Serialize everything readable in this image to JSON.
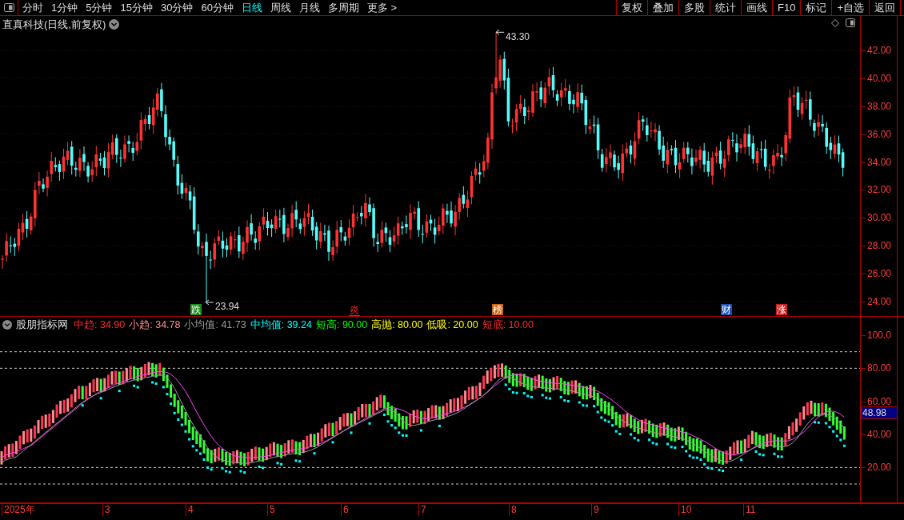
{
  "toolbar": {
    "periods": [
      {
        "label": "分时",
        "selected": false
      },
      {
        "label": "1分钟",
        "selected": false
      },
      {
        "label": "5分钟",
        "selected": false
      },
      {
        "label": "15分钟",
        "selected": false
      },
      {
        "label": "30分钟",
        "selected": false
      },
      {
        "label": "60分钟",
        "selected": false
      },
      {
        "label": "日线",
        "selected": true
      },
      {
        "label": "周线",
        "selected": false
      },
      {
        "label": "月线",
        "selected": false
      },
      {
        "label": "多周期",
        "selected": false
      },
      {
        "label": "更多 >",
        "selected": false
      }
    ],
    "buttons": [
      "复权",
      "叠加",
      "多股",
      "统计",
      "画线",
      "F10",
      "标记",
      "+自选",
      "返回"
    ]
  },
  "chart": {
    "title": "直真科技(日线,前复权)",
    "y_axis": [
      "42.00",
      "40.00",
      "38.00",
      "36.00",
      "34.00",
      "32.00",
      "30.00",
      "28.00",
      "26.00",
      "24.00"
    ],
    "high_label": "43.30",
    "low_label": "23.94",
    "events": [
      {
        "text": "跌",
        "kind": "tag",
        "color": "#1e8c1e"
      },
      {
        "text": "炎",
        "kind": "text",
        "color": "#ff2020"
      },
      {
        "text": "榜",
        "kind": "tag",
        "color": "#c86414"
      },
      {
        "text": "财",
        "kind": "tag",
        "color": "#1e50b4"
      },
      {
        "text": "涨",
        "kind": "tag",
        "color": "#c81e1e"
      }
    ]
  },
  "indicator": {
    "name": "股朋指标网",
    "legend": [
      {
        "text": "中趋: 34.90",
        "color": "#ff2a2a"
      },
      {
        "text": "小趋: 34.78",
        "color": "#ff8c8c"
      },
      {
        "text": "小均值: 41.73",
        "color": "#9a9a9a"
      },
      {
        "text": "中均值: 39.24",
        "color": "#00ffff"
      },
      {
        "text": "短高: 90.00",
        "color": "#00ff00"
      },
      {
        "text": "高抛: 80.00",
        "color": "#ffff00"
      },
      {
        "text": "低吸: 20.00",
        "color": "#ffff00"
      },
      {
        "text": "短底: 10.00",
        "color": "#ff2a2a"
      }
    ],
    "y_axis": [
      "100.0",
      "80.00",
      "60.00",
      "40.00",
      "20.00"
    ],
    "current_value": "48.98"
  },
  "time_axis": [
    "2025年",
    "3",
    "4",
    "5",
    "6",
    "7",
    "8",
    "9",
    "10",
    "11"
  ]
}
